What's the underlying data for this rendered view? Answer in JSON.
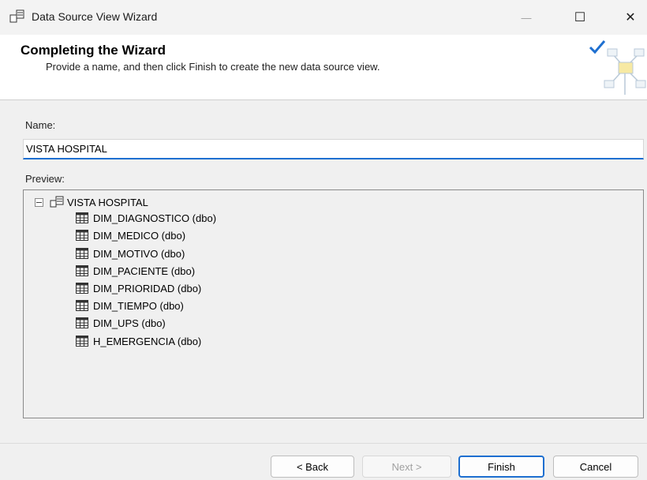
{
  "window": {
    "title": "Data Source View Wizard",
    "controls": {
      "minimize": "—",
      "maximize": "☐",
      "close": "✕"
    }
  },
  "header": {
    "title": "Completing the Wizard",
    "subtitle": "Provide a name, and then click Finish to create the new data source view."
  },
  "name_field": {
    "label": "Name:",
    "value": "VISTA HOSPITAL"
  },
  "preview": {
    "label": "Preview:",
    "root": "VISTA HOSPITAL",
    "items": [
      "DIM_DIAGNOSTICO (dbo)",
      "DIM_MEDICO (dbo)",
      "DIM_MOTIVO (dbo)",
      "DIM_PACIENTE (dbo)",
      "DIM_PRIORIDAD (dbo)",
      "DIM_TIEMPO (dbo)",
      "DIM_UPS (dbo)",
      "H_EMERGENCIA (dbo)"
    ]
  },
  "buttons": {
    "back": "< Back",
    "next": "Next >",
    "finish": "Finish",
    "cancel": "Cancel"
  },
  "colors": {
    "accent": "#1e6fd0",
    "disabled_text": "#a0a0a0"
  }
}
